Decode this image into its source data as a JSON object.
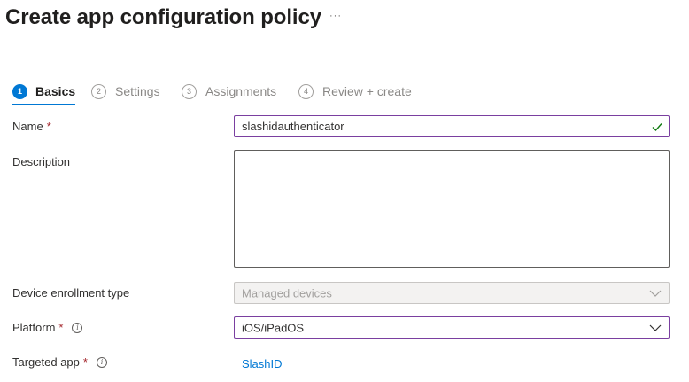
{
  "header": {
    "title": "Create app configuration policy",
    "more_label": "···"
  },
  "steps": [
    {
      "number": "1",
      "label": "Basics",
      "active": true
    },
    {
      "number": "2",
      "label": "Settings",
      "active": false
    },
    {
      "number": "3",
      "label": "Assignments",
      "active": false
    },
    {
      "number": "4",
      "label": "Review + create",
      "active": false
    }
  ],
  "form": {
    "name": {
      "label": "Name",
      "required_mark": "*",
      "value": "slashidauthenticator",
      "valid": true
    },
    "description": {
      "label": "Description",
      "value": ""
    },
    "enrollment": {
      "label": "Device enrollment type",
      "value": "Managed devices",
      "disabled": true
    },
    "platform": {
      "label": "Platform",
      "required_mark": "*",
      "value": "iOS/iPadOS",
      "info_glyph": "i"
    },
    "targeted_app": {
      "label": "Targeted app",
      "required_mark": "*",
      "value": "SlashID",
      "info_glyph": "i"
    }
  },
  "colors": {
    "accent": "#0078d4",
    "required": "#a4262c",
    "valid_check": "#107c10",
    "focus_border": "#7a3fa0"
  },
  "icons": {
    "valid": "check-icon",
    "dropdown": "chevron-down-icon",
    "info": "info-icon",
    "more": "more-ellipsis-icon"
  }
}
